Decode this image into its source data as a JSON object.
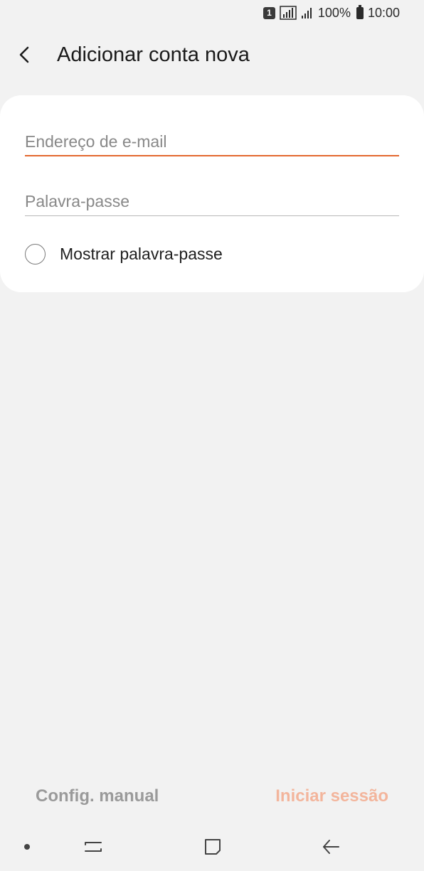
{
  "status_bar": {
    "sim_label": "1",
    "battery": "100%",
    "time": "10:00",
    "icons": [
      "sim-icon",
      "signal-icon",
      "signal-bars-icon",
      "battery-icon"
    ]
  },
  "header": {
    "back_icon": "chevron-left-icon",
    "title": "Adicionar conta nova"
  },
  "form": {
    "email_placeholder": "Endereço de e-mail",
    "password_placeholder": "Palavra-passe",
    "show_password_label": "Mostrar palavra-passe",
    "show_password_checked": false
  },
  "actions": {
    "manual_label": "Config. manual",
    "login_label": "Iniciar sessão"
  },
  "colors": {
    "accent": "#e3682f",
    "login_disabled": "#f3b59c",
    "background": "#f2f2f2"
  },
  "nav_bar": {
    "icons": [
      "dot-icon",
      "recent-apps-icon",
      "home-icon",
      "back-arrow-icon"
    ]
  }
}
